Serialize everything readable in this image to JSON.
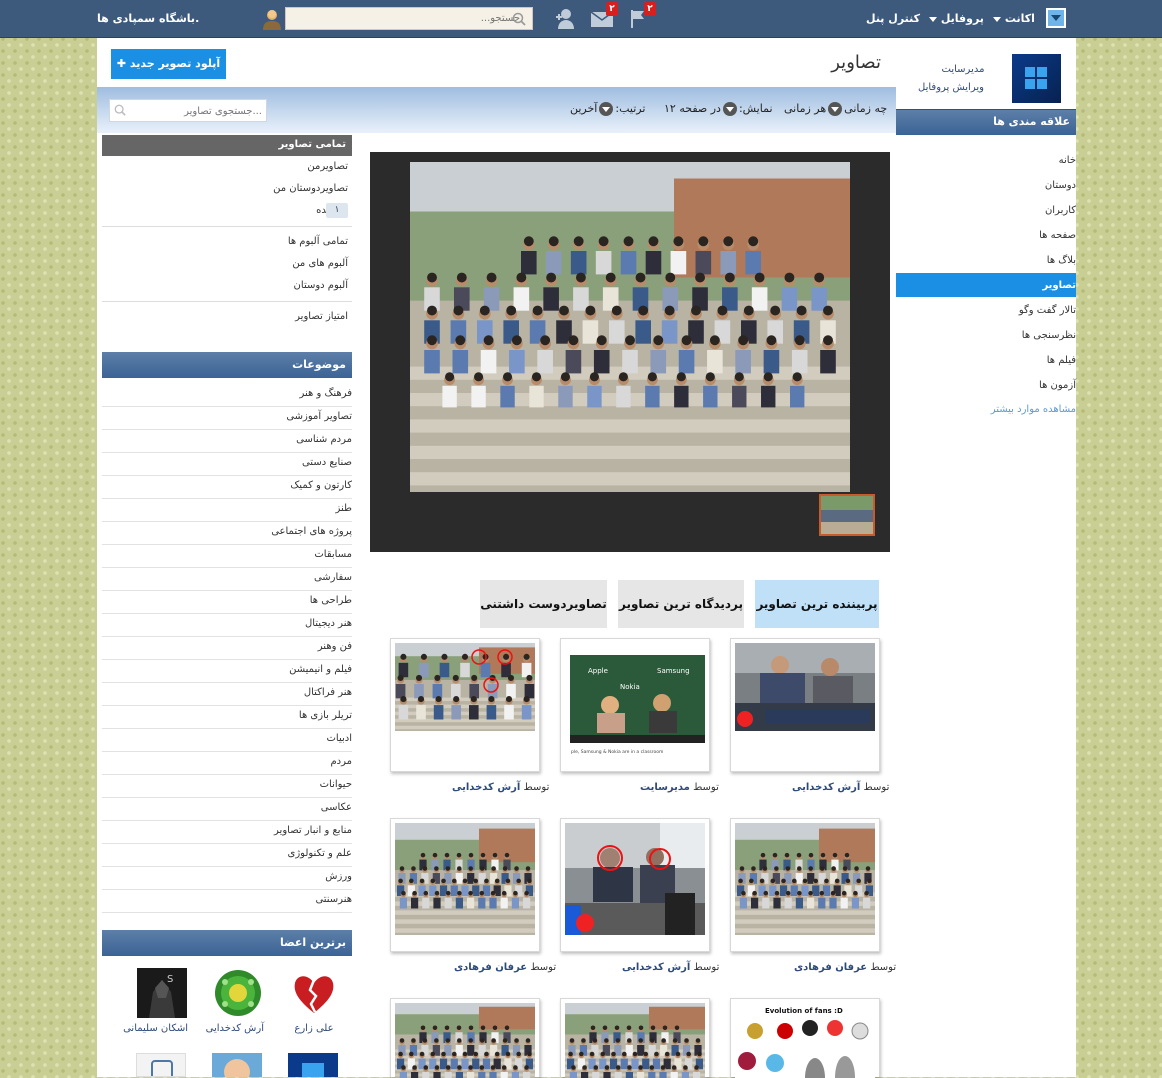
{
  "topbar": {
    "brand": "باشگاه سمپادی ها.",
    "search_placeholder": "جستجو...",
    "notif_badge": "۲",
    "mail_badge": "۲",
    "menu_account": "اکانت",
    "menu_profile": "پروفایل",
    "menu_control": "کنترل پنل"
  },
  "profile": {
    "name": "مدیرسایت",
    "edit": "ویرایش پروفایل"
  },
  "interests": {
    "title": "علاقه مندی ها",
    "items": [
      "خانه",
      "دوستان",
      "کاربران",
      "صفحه ها",
      "بلاگ ها",
      "تصاویر",
      "تالار گفت وگو",
      "نظرسنجی ها",
      "فیلم ها",
      "آزمون ها"
    ],
    "more": "مشاهده موارد بیشتر"
  },
  "page": {
    "title": "تصاویر",
    "upload_button": "آپلود تصویر جدید"
  },
  "filters": {
    "when_label": "چه زمانی",
    "when_value": "هر زمانی",
    "show_label": "نمایش",
    "show_value": "در صفحه ۱۲",
    "sort_label": "ترتیب",
    "sort_value": "آخرین",
    "search_placeholder": "جستجوی تصاویر..."
  },
  "left": {
    "all_photos_head": "تمامی تصاویر",
    "links1": [
      "تصاویرمن",
      "تصاویردوستان من",
      "برگزیده"
    ],
    "featured_count": "۱",
    "links2": [
      "تمامی آلبوم ها",
      "آلبوم های من",
      "آلبوم دوستان"
    ],
    "rating": "امتیاز تصاویر",
    "topics_head": "موضوعات",
    "topics": [
      "فرهنگ و هنر",
      "تصاویر آموزشی",
      "مردم شناسی",
      "صنایع دستی",
      "کارتون و کمیک",
      "طنز",
      "پروژه های اجتماعی",
      "مسابقات",
      "سفارشی",
      "طراحی ها",
      "هنر دیجیتال",
      "فن وهنر",
      "فیلم و انیمیشن",
      "هنر فراکتال",
      "تریلر بازی ها",
      "ادبیات",
      "مردم",
      "حیوانات",
      "عکاسی",
      "منابع و انبار تصاویر",
      "علم و تکنولوژی",
      "ورزش",
      "هنرسنتی"
    ],
    "members_head": "برترین اعضا",
    "members": [
      "علی زارع",
      "آرش کدخدایی",
      "اشکان سلیمانی"
    ]
  },
  "tabs": [
    "پربیننده ترین تصاویر",
    "پردیدگاه ترین تصاویر",
    "تصاویردوست داشتنی"
  ],
  "cards": [
    {
      "by": "توسط",
      "author": "آرش کدخدایی"
    },
    {
      "by": "توسط",
      "author": "مدیرسایت"
    },
    {
      "by": "توسط",
      "author": "آرش کدخدایی"
    },
    {
      "by": "توسط",
      "author": "عرفان فرهادی"
    },
    {
      "by": "توسط",
      "author": "آرش کدخدایی"
    },
    {
      "by": "توسط",
      "author": "عرفان فرهادی"
    }
  ],
  "card_texts": {
    "c2_brand1": "Apple",
    "c2_brand2": "Samsung",
    "c2_brand3": "Nokia",
    "c2_caption": "ple, Samsung & Nokia are in a classroom",
    "c7_title": "Evolution of fans :D"
  },
  "colors": {
    "topbar": "#3d5a7c",
    "accent": "#1a8fe3",
    "tab_active": "#bfe0f7"
  }
}
